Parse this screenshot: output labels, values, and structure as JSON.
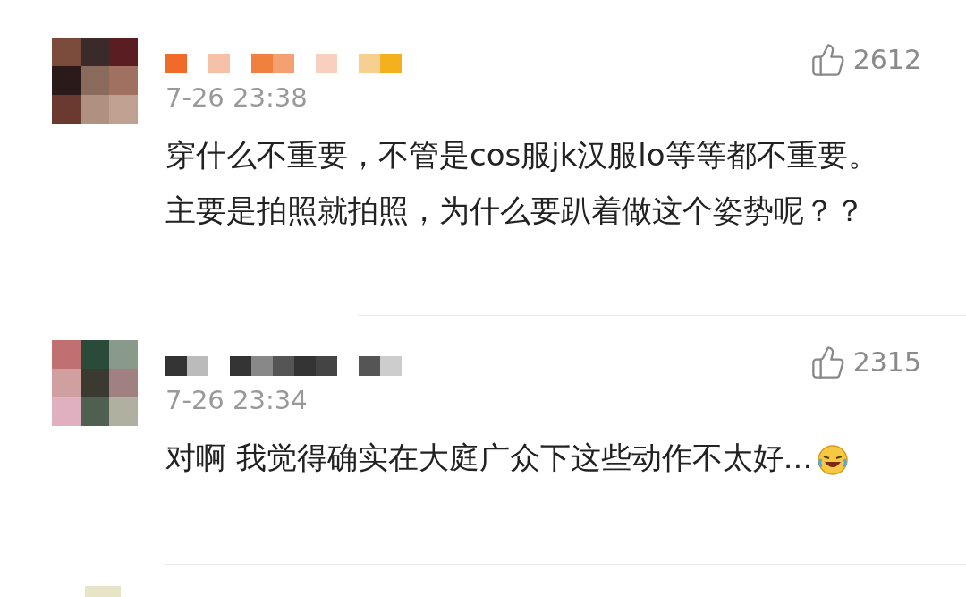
{
  "comments": [
    {
      "time": "7-26 23:38",
      "likes": "2612",
      "text": "穿什么不重要，不管是cos服jk汉服lo等等都不重要。主要是拍照就拍照，为什么要趴着做这个姿势呢？？",
      "emoji": false
    },
    {
      "time": "7-26 23:34",
      "likes": "2315",
      "text": "对啊 我觉得确实在大庭广众下这些动作不太好...",
      "emoji": true
    }
  ]
}
